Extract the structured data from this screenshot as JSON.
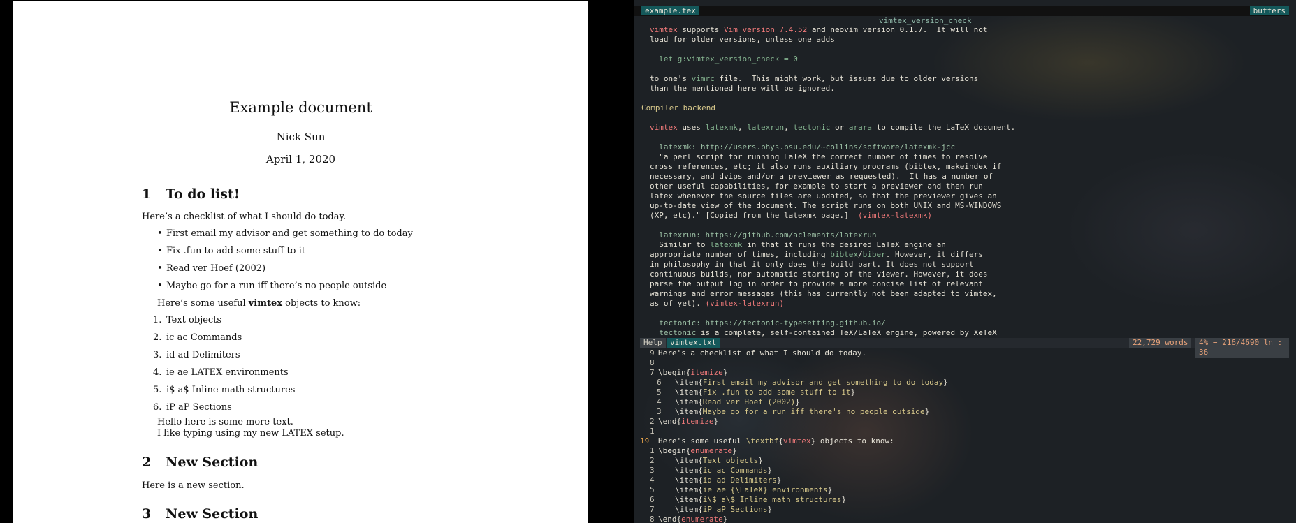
{
  "pdf": {
    "title": "Example document",
    "author": "Nick Sun",
    "date": "April 1, 2020",
    "sections": [
      {
        "num": "1",
        "title": "To do list!"
      },
      {
        "num": "2",
        "title": "New Section"
      },
      {
        "num": "3",
        "title": "New Section"
      }
    ],
    "intro": "Here’s a checklist of what I should do today.",
    "bullets": [
      "First email my advisor and get something to do today",
      "Fix .fun to add some stuff to it",
      "Read ver Hoef (2002)",
      "Maybe go for a run iff there’s no people outside"
    ],
    "useful_prefix": "Here’s some useful ",
    "useful_bold": "vimtex",
    "useful_suffix": " objects to know:",
    "enum": [
      {
        "n": "1.",
        "t": "Text objects"
      },
      {
        "n": "2.",
        "t": "ic ac Commands"
      },
      {
        "n": "3.",
        "t": "id ad Delimiters"
      },
      {
        "n": "4.",
        "t": "ie ae LATEX environments"
      },
      {
        "n": "5.",
        "t": "i$ a$ Inline math structures"
      },
      {
        "n": "6.",
        "t": "iP aP Sections"
      }
    ],
    "hello1": "Hello here is some more text.",
    "hello2": "I like typing using my new LATEX setup.",
    "sec2_text": "Here is a new section."
  },
  "vim": {
    "tab_file": "example.tex",
    "tab_buffers": "buffers",
    "help_tag": "vimtex_version_check",
    "statusline": {
      "mode": "Help",
      "file": "vimtex.txt",
      "words": "22,729 words",
      "position": "4% ≡  216/4690 ln : 36"
    },
    "cursor_line_number": "19"
  }
}
